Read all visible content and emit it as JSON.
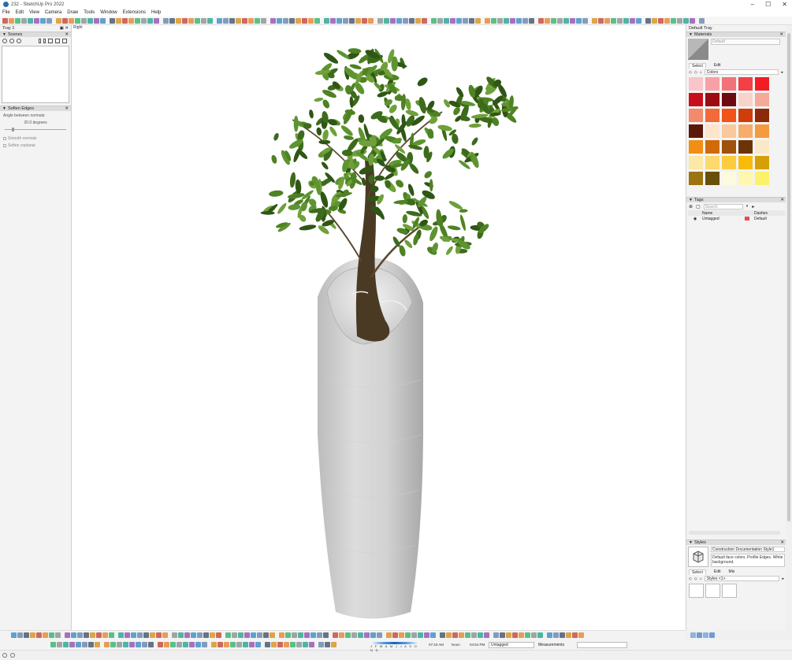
{
  "window": {
    "title": "232 - SketchUp Pro 2022",
    "controls": [
      "–",
      "☐",
      "✕"
    ]
  },
  "menu": [
    "File",
    "Edit",
    "View",
    "Camera",
    "Draw",
    "Tools",
    "Window",
    "Extensions",
    "Help"
  ],
  "left_tray": {
    "title": "Tray 1",
    "scenes": {
      "title": "Scenes"
    },
    "soften": {
      "title": "Soften Edges",
      "angle_label": "Angle between normals:",
      "angle_value": "20.0  degrees",
      "angle_fraction": 0.11,
      "smooth_normals": "Smooth normals",
      "soften_coplanar": "Soften coplanar"
    }
  },
  "viewport": {
    "view_name": "Right"
  },
  "right_tray": {
    "title": "Default Tray",
    "materials": {
      "title": "Materials",
      "name": "Default",
      "tabs": [
        "Select",
        "Edit"
      ],
      "library": "Colors",
      "swatch_colors": [
        "#f9c5c8",
        "#f7a0a6",
        "#f27377",
        "#f24045",
        "#f21d24",
        "#c8101b",
        "#9c0a12",
        "#6d0a10",
        "#f8d3c8",
        "#f6a996",
        "#f28b6c",
        "#f26a3a",
        "#f05418",
        "#cf3d0a",
        "#8a2a06",
        "#5a1808",
        "#fde5cc",
        "#f9c89c",
        "#f7ad6a",
        "#f49a3f",
        "#f08f14",
        "#d06b08",
        "#a0520a",
        "#6c3306",
        "#fbe9c5",
        "#fde8a6",
        "#fdd86d",
        "#fccc3e",
        "#f8bc08",
        "#d4a006",
        "#9c7410",
        "#6a4f0a",
        "#fefae0",
        "#fdf7b0",
        "#fbf16b"
      ]
    },
    "tags": {
      "title": "Tags",
      "search_placeholder": "Search",
      "columns": [
        "Name",
        "Dashes"
      ],
      "rows": [
        {
          "name": "Untagged",
          "color": "#e74c4c",
          "dashes": "Default"
        }
      ]
    },
    "styles": {
      "title": "Styles",
      "name": "Construction Documentation Style1",
      "description": "Default face colors. Profile Edges. White background.",
      "tabs": [
        "Select",
        "Edit",
        "Mix"
      ],
      "library": "Styles <1>"
    }
  },
  "status": {
    "shadow_months": "J F M A M J J A S O N D",
    "time_am": "07:43 AM",
    "noon": "Noon",
    "time_pm": "04:54 PM",
    "tag": "Untagged",
    "measurements_label": "Measurements"
  }
}
